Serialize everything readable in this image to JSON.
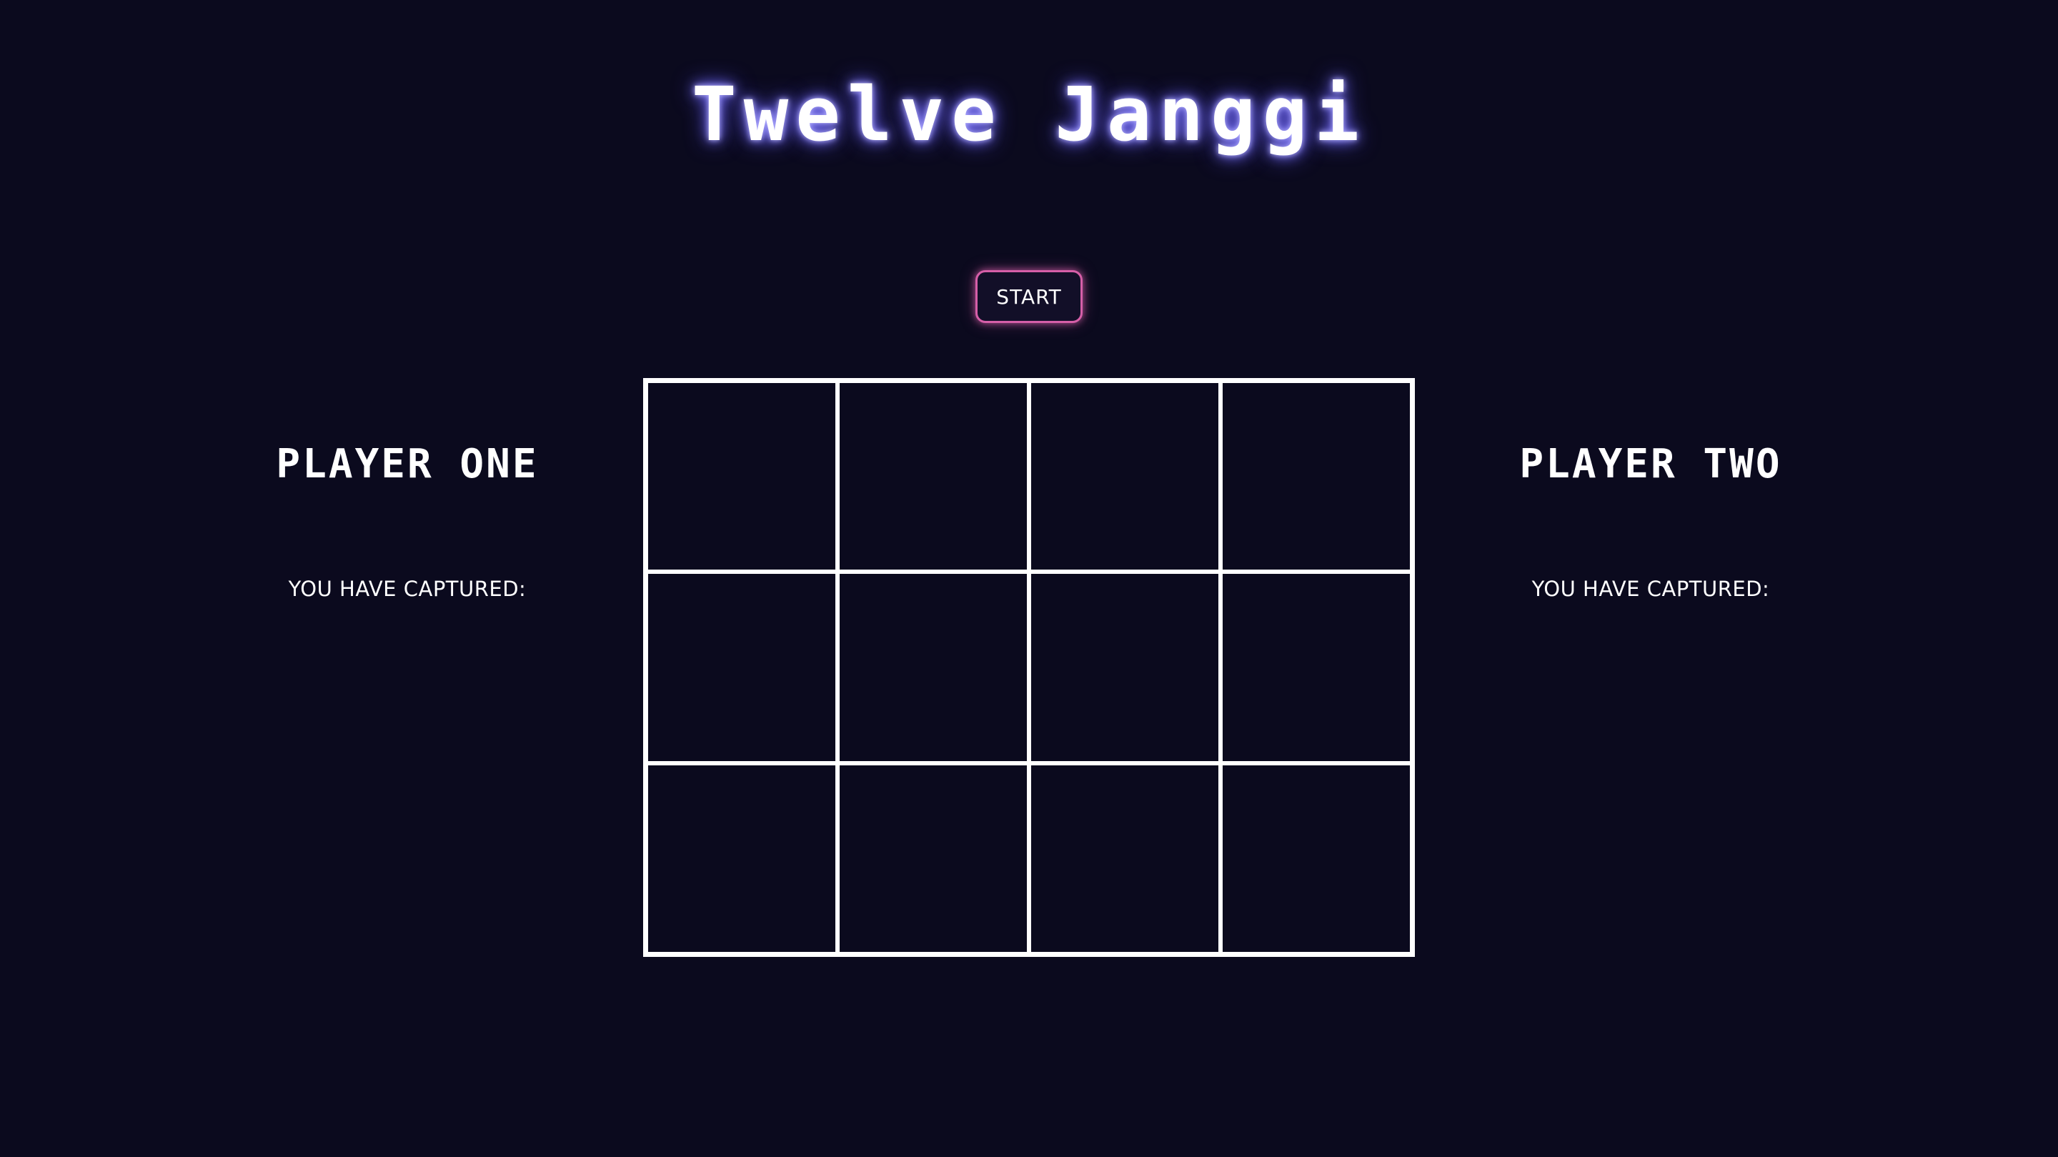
{
  "title": "Twelve Janggi",
  "start_button": {
    "label": "START"
  },
  "players": [
    {
      "name": "PLAYER ONE",
      "captured_label": "YOU HAVE CAPTURED:"
    },
    {
      "name": "PLAYER TWO",
      "captured_label": "YOU HAVE CAPTURED:"
    }
  ],
  "board": {
    "rows": 3,
    "columns": 4
  },
  "colors": {
    "background": "#0b0a1e",
    "grid": "#ffffff",
    "title_glow": "#7a73ff",
    "button_border": "#d65fa8"
  }
}
